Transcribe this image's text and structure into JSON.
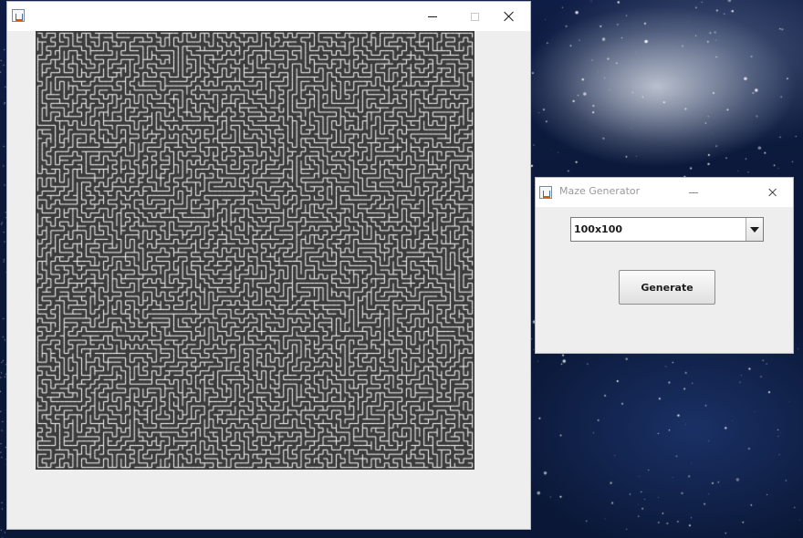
{
  "maze_window": {
    "title": "",
    "grid_cols": 100,
    "grid_rows": 100,
    "colors": {
      "frame_bg": "#eeeeee",
      "maze_bg": "#3b3b3b",
      "maze_path": "#ffffff"
    }
  },
  "generator_window": {
    "title": "Maze Generator",
    "size_select": {
      "value": "100x100"
    },
    "generate_label": "Generate"
  },
  "icons": [
    "java-app-icon",
    "minimize-icon",
    "maximize-icon",
    "close-icon",
    "dropdown-arrow-icon"
  ]
}
